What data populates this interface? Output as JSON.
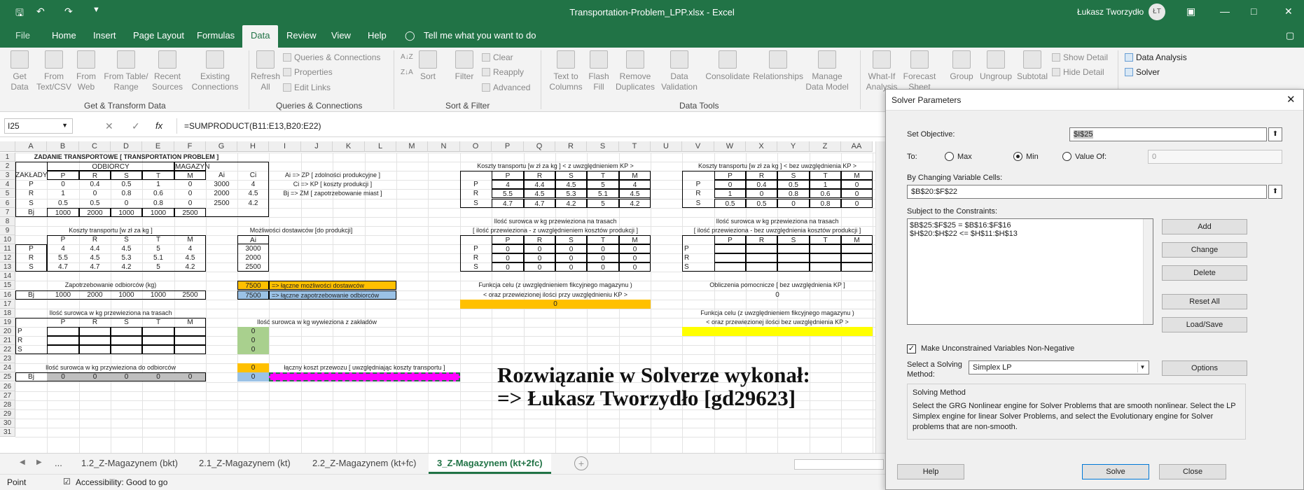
{
  "titlebar": {
    "title": "Transportation-Problem_LPP.xlsx  -  Excel",
    "user": "Łukasz Tworzydło",
    "initials": "ŁT"
  },
  "tabs": [
    "File",
    "Home",
    "Insert",
    "Page Layout",
    "Formulas",
    "Data",
    "Review",
    "View",
    "Help"
  ],
  "active_tab": "Data",
  "tell_me": "Tell me what you want to do",
  "ribbon": {
    "get_data": "Get Data",
    "from_text": "From Text/CSV",
    "from_web": "From Web",
    "from_table": "From Table/ Range",
    "recent": "Recent Sources",
    "existing": "Existing Connections",
    "refresh": "Refresh All",
    "queries": "Queries & Connections",
    "properties": "Properties",
    "edit_links": "Edit Links",
    "sort": "Sort",
    "filter": "Filter",
    "clear": "Clear",
    "reapply": "Reapply",
    "advanced": "Advanced",
    "text_to_columns": "Text to Columns",
    "flash_fill": "Flash Fill",
    "remove_dup": "Remove Duplicates",
    "data_validation": "Data Validation",
    "consolidate": "Consolidate",
    "relationships": "Relationships",
    "manage_model": "Manage Data Model",
    "whatif": "What-If Analysis",
    "forecast": "Forecast Sheet",
    "group": "Group",
    "ungroup": "Ungroup",
    "subtotal": "Subtotal",
    "show_detail": "Show Detail",
    "hide_detail": "Hide Detail",
    "data_analysis": "Data Analysis",
    "solver": "Solver",
    "groups": [
      "Get & Transform Data",
      "Queries & Connections",
      "Sort & Filter",
      "Data Tools"
    ]
  },
  "formula_bar": {
    "namebox": "I25",
    "fx": "fx",
    "formula": "=SUMPRODUCT(B11:E13,B20:E22)"
  },
  "columns": [
    "A",
    "B",
    "C",
    "D",
    "E",
    "F",
    "G",
    "H",
    "I",
    "J",
    "K",
    "L",
    "M",
    "N",
    "O",
    "P",
    "Q",
    "R",
    "S",
    "T",
    "U",
    "V",
    "W",
    "X",
    "Y",
    "Z",
    "AA"
  ],
  "sheet": {
    "t1_title": "ZADANIE TRANSPORTOWE [ TRANSPORTATION PROBLEM ]",
    "odbiorcy": "ODBIORCY",
    "magazyn": "MAGAZYN",
    "zaklady": "ZAKŁADY",
    "hdr": [
      "P",
      "R",
      "S",
      "T",
      "M"
    ],
    "ai": "Ai",
    "ci": "Ci",
    "bj": "Bj",
    "rows": [
      "P",
      "R",
      "S"
    ],
    "t1_data": [
      [
        "0",
        "0.4",
        "0.5",
        "1",
        "0",
        "3000",
        "4"
      ],
      [
        "1",
        "0",
        "0.8",
        "0.6",
        "0",
        "2000",
        "4.5"
      ],
      [
        "0.5",
        "0.5",
        "0",
        "0.8",
        "0",
        "2500",
        "4.2"
      ]
    ],
    "t1_bj": [
      "1000",
      "2000",
      "1000",
      "1000",
      "2500"
    ],
    "legend": [
      "Ai => ZP [ zdolności produkcyjne ]",
      "Ci => KP [ koszty produkcji ]",
      "Bj => ZM [ zapotrzebowanie miast ]"
    ],
    "koszty_title": "Koszty transportu [w zł za kg ]",
    "koszty_data": [
      [
        "4",
        "4.4",
        "4.5",
        "5",
        "4"
      ],
      [
        "5.5",
        "4.5",
        "5.3",
        "5.1",
        "4.5"
      ],
      [
        "4.7",
        "4.7",
        "4.2",
        "5",
        "4.2"
      ]
    ],
    "mozliwosci_title": "Możliwości dostawców [do produkcji]",
    "mozliwosci": [
      "3000",
      "2000",
      "2500"
    ],
    "zapotrz_title": "Zapotrzebowanie odbiorców (kg)",
    "zapotrz": [
      "1000",
      "2000",
      "1000",
      "1000",
      "2500"
    ],
    "sum1": "7500",
    "sum1_label": "=> łączne możliwości dostawców",
    "sum2": "7500",
    "sum2_label": "=> łączne zapotrzebowanie odbiorców",
    "przewieziona_title": "Ilość surowca w kg przewieziona na trasach",
    "wywieziona_title": "Ilość surowca w kg wywieziona z zakładów",
    "wywieziona": [
      "0",
      "0",
      "0"
    ],
    "przywieziona_title": "Ilość surowca w kg przywieziona do odbiorców",
    "przywieziona": [
      "0",
      "0",
      "0",
      "0",
      "0"
    ],
    "i24": "0",
    "h25": "0",
    "laczny_koszt": "łączny koszt przewozu [ uwzględniając koszty transportu ]",
    "kp_title": "Koszty transportu [w zł za kg ] < z uwzględnieniem KP >",
    "kp_data": [
      [
        "4",
        "4.4",
        "4.5",
        "5",
        "4"
      ],
      [
        "5.5",
        "4.5",
        "5.3",
        "5.1",
        "4.5"
      ],
      [
        "4.7",
        "4.7",
        "4.2",
        "5",
        "4.2"
      ]
    ],
    "bkp_title": "Koszty transportu [w zł za kg ] < bez uwzględnienia KP >",
    "bkp_data": [
      [
        "0",
        "0.4",
        "0.5",
        "1",
        "0"
      ],
      [
        "1",
        "0",
        "0.8",
        "0.6",
        "0"
      ],
      [
        "0.5",
        "0.5",
        "0",
        "0.8",
        "0"
      ]
    ],
    "przew_kp_1": "Ilość surowca w kg przewieziona na trasach",
    "przew_kp_2": "[ ilość przewieziona - z uwzględnieniem kosztów produkcji ]",
    "przew_kp": [
      [
        "0",
        "0",
        "0",
        "0",
        "0"
      ],
      [
        "0",
        "0",
        "0",
        "0",
        "0"
      ],
      [
        "0",
        "0",
        "0",
        "0",
        "0"
      ]
    ],
    "przew_bkp_2": "[ ilość przewieziona - bez uwzględnienia kosztów produkcji ]",
    "fc1": "Funkcja celu (z uwzględnieniem fikcyjnego magazynu )",
    "fc2": "< oraz przewiezionej ilości przy uwzględnieniu KP >",
    "fc_val": "0",
    "oblicz": "Obliczenia pomocnicze [ bez uwzględnienia KP ]",
    "oblicz_val": "0",
    "fc3": "Funkcja celu (z uwzględnieniem fikcyjnego magazynu )",
    "fc4": "< oraz przewiezionej ilości bez uwzględnienia KP >",
    "big1": "Rozwiązanie w Solverze wykonał:",
    "big2": "=> Łukasz Tworzydło [gd29623]"
  },
  "sheet_tabs": [
    "...",
    "1.2_Z-Magazynem (bkt)",
    "2.1_Z-Magazynem (kt)",
    "2.2_Z-Magazynem (kt+fc)",
    "3_Z-Magazynem (kt+2fc)"
  ],
  "status": {
    "mode": "Point",
    "accessibility": "Accessibility: Good to go"
  },
  "solver": {
    "title": "Solver Parameters",
    "set_objective_label": "Set Objective:",
    "objective": "$I$25",
    "to_label": "To:",
    "max": "Max",
    "min": "Min",
    "value_of": "Value Of:",
    "value": "0",
    "changing_label": "By Changing Variable Cells:",
    "changing": "$B$20:$F$22",
    "constraints_label": "Subject to the Constraints:",
    "constraints": [
      "$B$25:$F$25 = $B$16:$F$16",
      "$H$20:$H$22 <= $H$11:$H$13"
    ],
    "add": "Add",
    "change": "Change",
    "delete": "Delete",
    "reset": "Reset All",
    "loadsave": "Load/Save",
    "nonneg": "Make Unconstrained Variables Non-Negative",
    "method_label": "Select a Solving Method:",
    "method": "Simplex LP",
    "options": "Options",
    "sm_title": "Solving Method",
    "sm_text": "Select the GRG Nonlinear engine for Solver Problems that are smooth nonlinear. Select the LP Simplex engine for linear Solver Problems, and select the Evolutionary engine for Solver problems that are non-smooth.",
    "help": "Help",
    "solve": "Solve",
    "close": "Close"
  },
  "colors": {
    "excel_green": "#217346",
    "yellow": "#ffc000",
    "blue": "#9bc2e6",
    "green": "#a9d08e",
    "pink": "#ff00ff",
    "bright_yellow": "#ffff00"
  }
}
